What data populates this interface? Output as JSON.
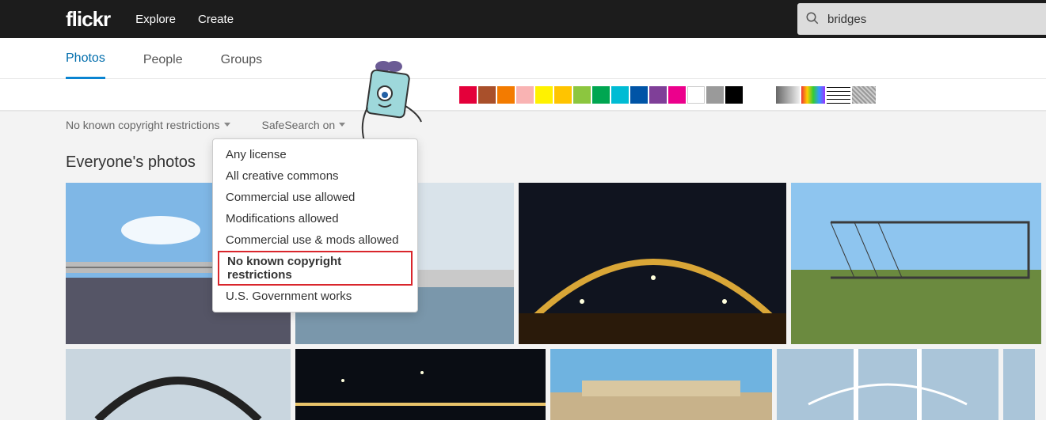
{
  "header": {
    "logo": "flickr",
    "nav": [
      "Explore",
      "Create"
    ],
    "search": {
      "value": "bridges",
      "placeholder": "Search"
    }
  },
  "tabs": [
    {
      "label": "Photos",
      "active": true
    },
    {
      "label": "People",
      "active": false
    },
    {
      "label": "Groups",
      "active": false
    }
  ],
  "colors": [
    "#e4003a",
    "#a9502b",
    "#f37b00",
    "#f9b3b3",
    "#fff200",
    "#ffc400",
    "#8cc63f",
    "#00a651",
    "#00bcd4",
    "#0054a6",
    "#7f3f98",
    "#ec008c",
    "#ffffff",
    "#9a9a9a",
    "#000000"
  ],
  "extra_patterns": [
    "gradient",
    "rainbow",
    "grid",
    "noise"
  ],
  "filters": {
    "license": {
      "label": "No known copyright restrictions"
    },
    "safesearch": {
      "label": "SafeSearch on"
    }
  },
  "license_dropdown": {
    "items": [
      "Any license",
      "All creative commons",
      "Commercial use allowed",
      "Modifications allowed",
      "Commercial use & mods allowed",
      "No known copyright restrictions",
      "U.S. Government works"
    ],
    "selected_index": 5
  },
  "section_title": "Everyone's photos"
}
